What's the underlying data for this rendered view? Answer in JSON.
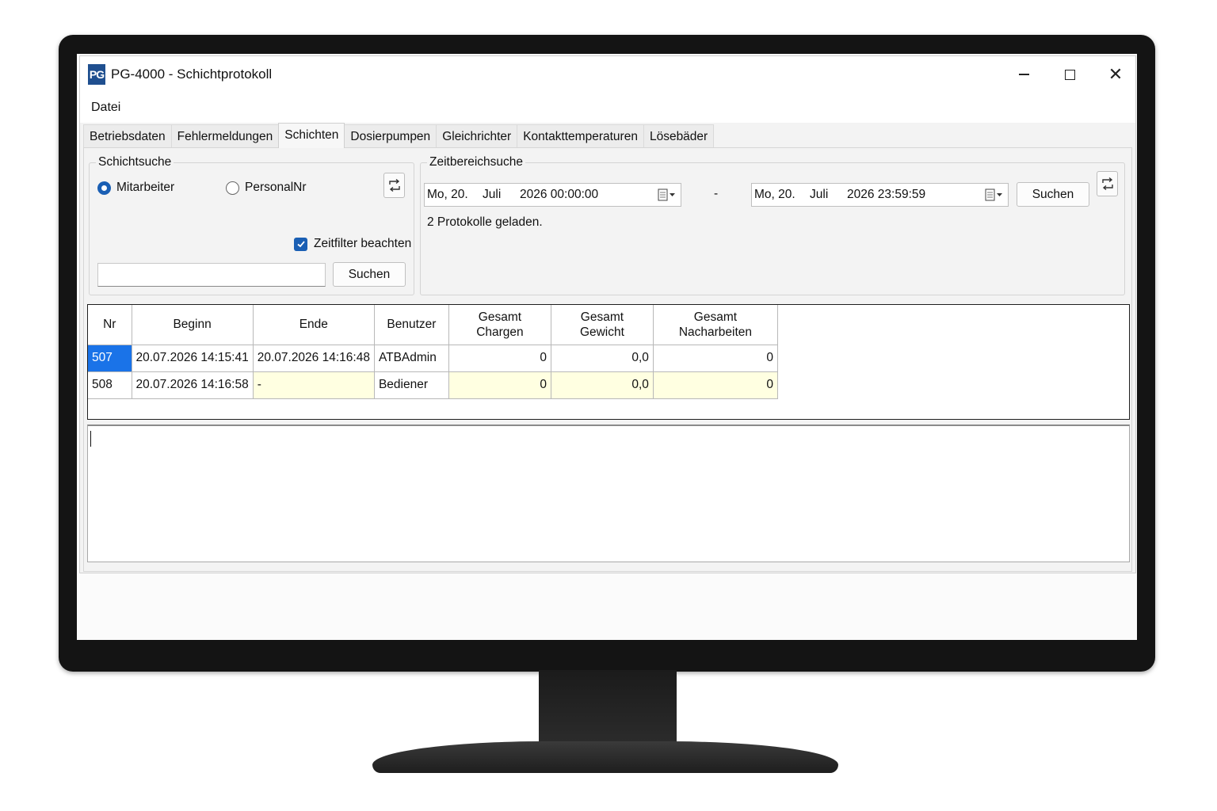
{
  "window": {
    "logo_text": "PG",
    "title": "PG-4000 - Schichtprotokoll",
    "minimize": "minimize",
    "maximize": "maximize",
    "close": "✕"
  },
  "menu": {
    "file": "Datei"
  },
  "tabs": [
    {
      "label": "Betriebsdaten"
    },
    {
      "label": "Fehlermeldungen"
    },
    {
      "label": "Schichten",
      "active": true
    },
    {
      "label": "Dosierpumpen"
    },
    {
      "label": "Gleichrichter"
    },
    {
      "label": "Kontakttemperaturen"
    },
    {
      "label": "Lösebäder"
    }
  ],
  "shift_search": {
    "title": "Schichtsuche",
    "radio_employee": "Mitarbeiter",
    "radio_personal_nr": "PersonalNr",
    "selected": "Mitarbeiter",
    "time_filter_label": "Zeitfilter beachten",
    "time_filter_checked": true,
    "search_value": "",
    "search_button": "Suchen"
  },
  "time_range": {
    "title": "Zeitbereichsuche",
    "from": {
      "day": "Mo, 20.",
      "month": "Juli",
      "rest": "2026 00:00:00"
    },
    "separator": "-",
    "to": {
      "day": "Mo, 20.",
      "month": "Juli",
      "rest": "2026 23:59:59"
    },
    "search_button": "Suchen",
    "status": "2 Protokolle geladen."
  },
  "grid": {
    "columns": [
      {
        "label": "Nr"
      },
      {
        "label": "Beginn"
      },
      {
        "label": "Ende"
      },
      {
        "label": "Benutzer"
      },
      {
        "label": "Gesamt\nChargen"
      },
      {
        "label": "Gesamt\nGewicht"
      },
      {
        "label": "Gesamt\nNacharbeiten"
      }
    ],
    "rows": [
      [
        "507",
        "20.07.2026 14:15:41",
        "20.07.2026 14:16:48",
        "ATBAdmin",
        "0",
        "0,0",
        "0"
      ],
      [
        "508",
        "20.07.2026 14:16:58",
        "-",
        "Bediener",
        "0",
        "0,0",
        "0"
      ]
    ]
  },
  "colors": {
    "accent": "#1a5fb4",
    "selection": "#1a73e8",
    "open_row": "#ffffe1"
  },
  "icons": {
    "refresh": "refresh-icon",
    "calendar": "calendar-icon",
    "dropdown": "dropdown-arrow-icon"
  }
}
